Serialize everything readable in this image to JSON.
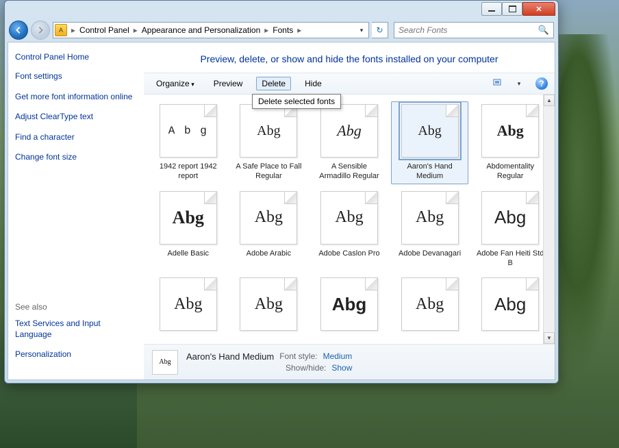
{
  "breadcrumbs": [
    "Control Panel",
    "Appearance and Personalization",
    "Fonts"
  ],
  "search": {
    "placeholder": "Search Fonts"
  },
  "sidebar": {
    "home": "Control Panel Home",
    "links": [
      "Font settings",
      "Get more font information online",
      "Adjust ClearType text",
      "Find a character",
      "Change font size"
    ],
    "see_also_label": "See also",
    "see_also": [
      "Text Services and Input Language",
      "Personalization"
    ]
  },
  "heading": "Preview, delete, or show and hide the fonts installed on your computer",
  "toolbar": {
    "organize": "Organize",
    "preview": "Preview",
    "delete": "Delete",
    "hide": "Hide"
  },
  "tooltip": "Delete selected fonts",
  "fonts": [
    {
      "name": "1942 report 1942 report",
      "sample": "A b g",
      "stack": false,
      "style": "font-family: Courier, monospace; letter-spacing:2px; font-size:16px;"
    },
    {
      "name": "A Safe Place to Fall Regular",
      "sample": "Abg",
      "stack": false,
      "style": "font-family: 'Comic Sans MS', cursive; font-size:20px;"
    },
    {
      "name": "A Sensible Armadillo Regular",
      "sample": "Abg",
      "stack": false,
      "style": "font-family: Georgia, serif; font-style:italic; font-size:22px;"
    },
    {
      "name": "Aaron's Hand Medium",
      "sample": "Abg",
      "stack": false,
      "selected": true,
      "style": "font-family: 'Segoe Script', cursive; font-size:20px;"
    },
    {
      "name": "Abdomentality Regular",
      "sample": "Abg",
      "stack": false,
      "style": "font-family: Impact; font-weight:900; font-size:22px;"
    },
    {
      "name": "Adelle Basic",
      "sample": "Abg",
      "stack": true,
      "style": "font-family: Georgia; font-weight:bold; font-size:26px;"
    },
    {
      "name": "Adobe Arabic",
      "sample": "Abg",
      "stack": true,
      "style": "font-family: 'Times New Roman'; font-size:24px;"
    },
    {
      "name": "Adobe Caslon Pro",
      "sample": "Abg",
      "stack": true,
      "style": "font-family: 'Times New Roman'; font-size:24px;"
    },
    {
      "name": "Adobe Devanagari",
      "sample": "Abg",
      "stack": true,
      "style": "font-family: Georgia; font-size:24px;"
    },
    {
      "name": "Adobe Fan Heiti Std B",
      "sample": "Abg",
      "stack": true,
      "style": "font-family: Arial; font-size:26px;"
    },
    {
      "name": "",
      "sample": "Abg",
      "stack": true,
      "style": "font-family: Georgia; font-size:24px;"
    },
    {
      "name": "",
      "sample": "Abg",
      "stack": true,
      "style": "font-family: Georgia; font-size:24px;"
    },
    {
      "name": "",
      "sample": "Abg",
      "stack": true,
      "style": "font-family: Arial; font-weight:bold; font-size:26px;"
    },
    {
      "name": "",
      "sample": "Abg",
      "stack": true,
      "style": "font-family: 'Times New Roman'; font-size:24px;"
    },
    {
      "name": "",
      "sample": "Abg",
      "stack": true,
      "style": "font-family: Arial; font-size:26px;"
    }
  ],
  "details": {
    "name": "Aaron's Hand Medium",
    "style_label": "Font style:",
    "style_val": "Medium",
    "show_label": "Show/hide:",
    "show_val": "Show",
    "thumb": "Abg"
  }
}
